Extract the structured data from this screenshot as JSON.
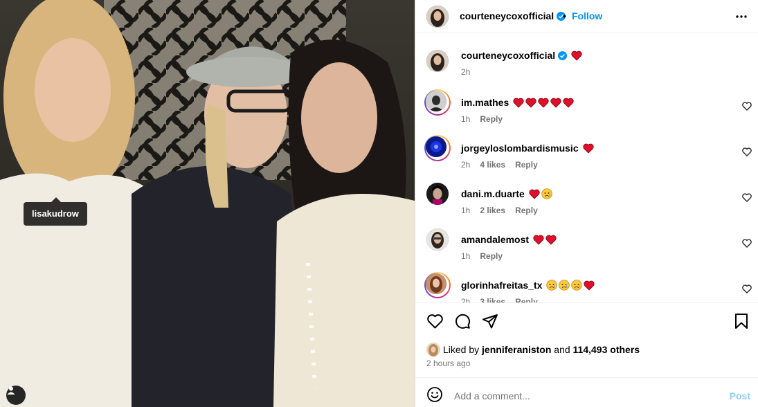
{
  "photo": {
    "tagged_user": "lisakudrow"
  },
  "post": {
    "author": "courteneycoxofficial",
    "follow_label": "Follow",
    "caption_time": "2h"
  },
  "comments": [
    {
      "user": "im.mathes",
      "emojis": "❤️❤️❤️❤️❤️",
      "time": "1h",
      "likes": "",
      "reply": "Reply"
    },
    {
      "user": "jorgeyloslombardismusic",
      "emojis": "❤️",
      "time": "2h",
      "likes": "4 likes",
      "reply": "Reply"
    },
    {
      "user": "dani.m.duarte",
      "emojis": "❤️😥",
      "time": "1h",
      "likes": "2 likes",
      "reply": "Reply"
    },
    {
      "user": "amandalemost",
      "emojis": "❤️❤️",
      "time": "1h",
      "likes": "",
      "reply": "Reply"
    },
    {
      "user": "glorinhafreitas_tx",
      "emojis": "😥😥😥❤️",
      "time": "2h",
      "likes": "3 likes",
      "reply": "Reply"
    }
  ],
  "likes": {
    "prefix": "Liked by",
    "user": "jenniferaniston",
    "and": "and",
    "count": "114,493 others"
  },
  "time_ago": "2 hours ago",
  "composer": {
    "placeholder": "Add a comment...",
    "post_label": "Post"
  },
  "colors": {
    "link_blue": "#0095f6",
    "muted": "#737373",
    "verified": "#0095f6",
    "heart_red": "#ff3040"
  }
}
